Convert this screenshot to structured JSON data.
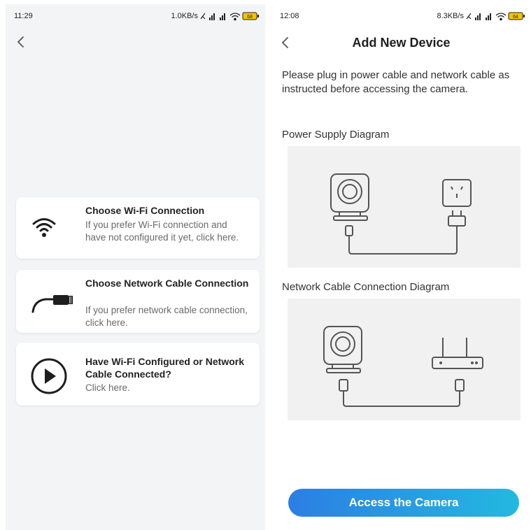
{
  "left_screen": {
    "statusbar": {
      "time": "11:29",
      "speed": "1.0KB/s",
      "battery": "68"
    },
    "options": [
      {
        "title": "Choose Wi-Fi Connection",
        "description": "If you prefer Wi-Fi connection and have not configured it yet, click here.",
        "icon": "wifi-icon"
      },
      {
        "title": "Choose Network Cable Connection",
        "description": "If you prefer network cable connection, click here.",
        "icon": "network-cable-icon"
      },
      {
        "title": "Have Wi-Fi Configured or Network Cable Connected?",
        "description": "Click here.",
        "icon": "play-icon"
      }
    ]
  },
  "right_screen": {
    "statusbar": {
      "time": "12:08",
      "speed": "8.3KB/s",
      "battery": "64"
    },
    "header": {
      "title": "Add New Device"
    },
    "intro": "Please plug in power cable and network cable as instructed before accessing the camera.",
    "sections": [
      {
        "title": "Power Supply Diagram"
      },
      {
        "title": "Network Cable Connection Diagram"
      }
    ],
    "primary_button": "Access the Camera"
  },
  "colors": {
    "accent_start": "#2b7ee3",
    "accent_end": "#23b9e0",
    "background_left": "#f3f4f6",
    "diagram_background": "#f1f1f1"
  }
}
